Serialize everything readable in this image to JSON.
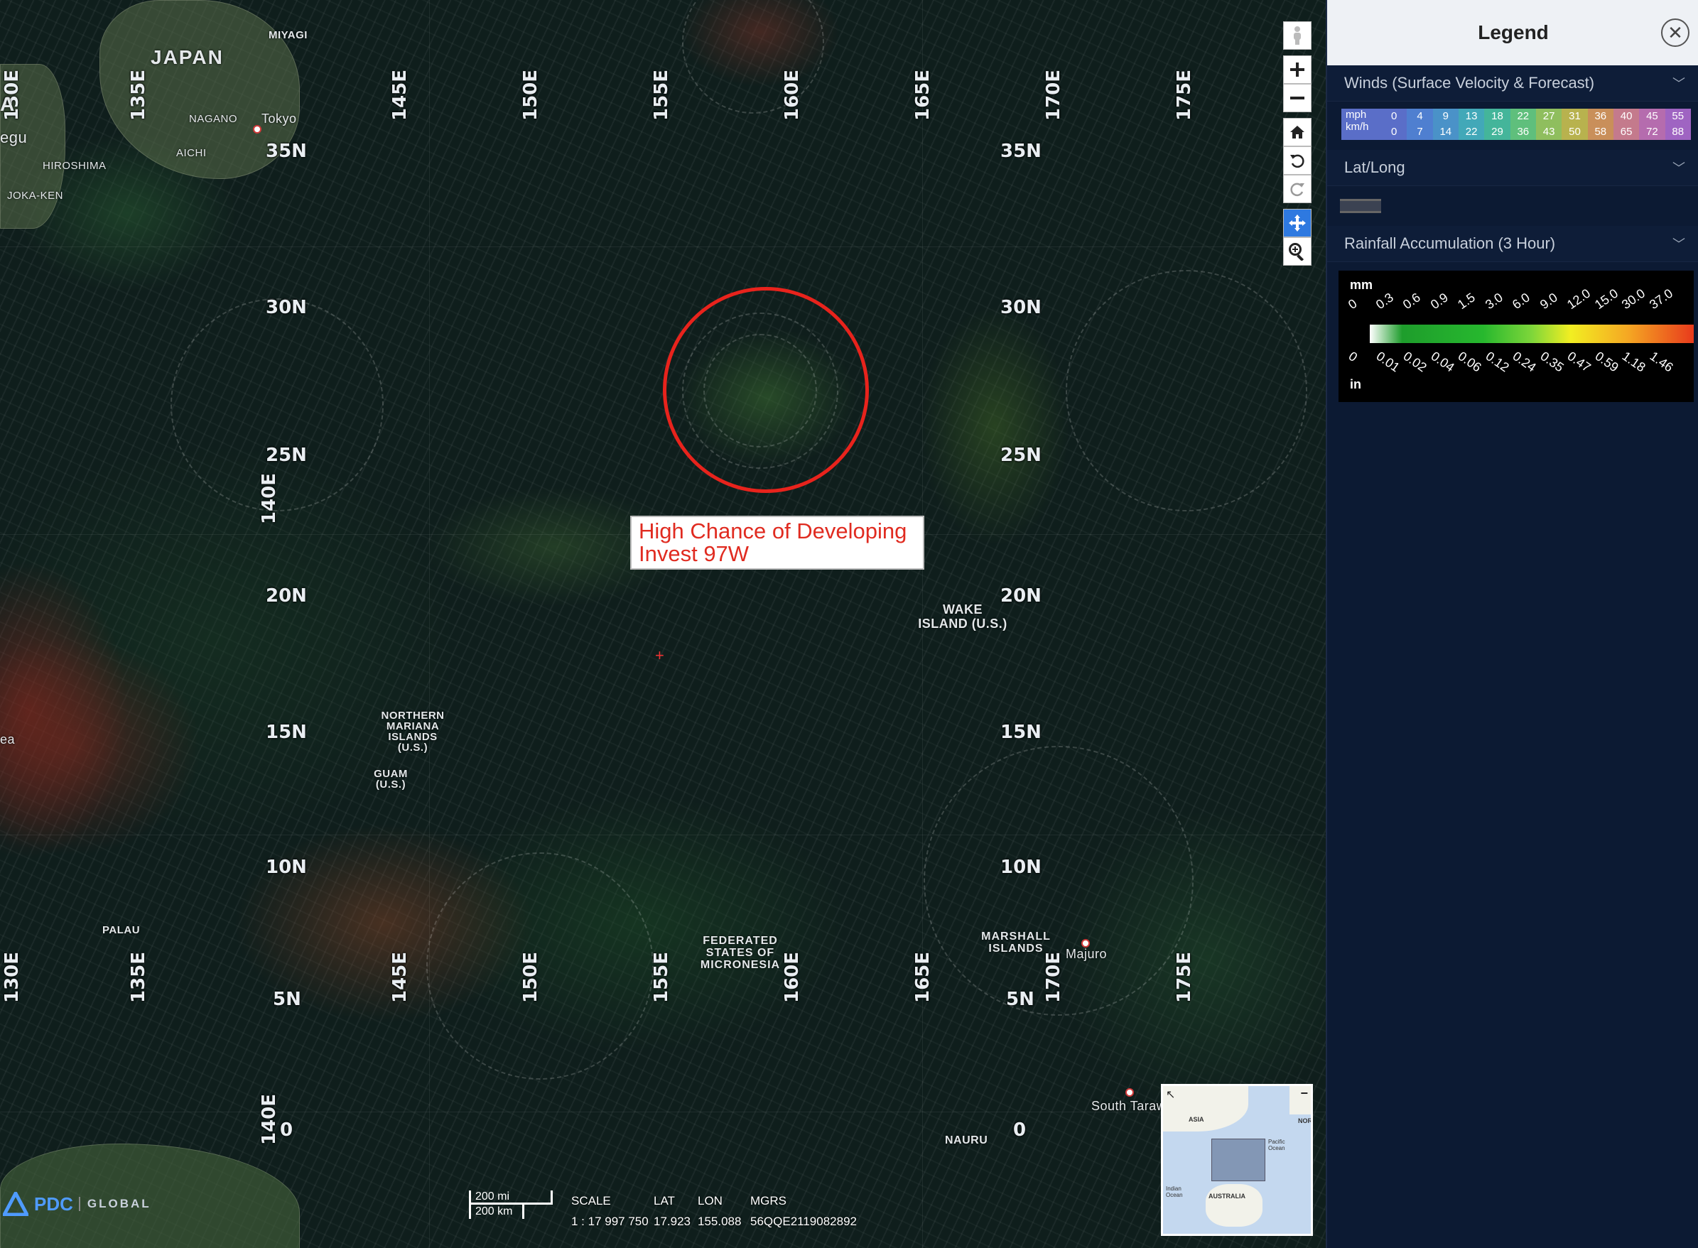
{
  "map": {
    "longitude_labels": [
      "130E",
      "135E",
      "140E",
      "145E",
      "150E",
      "155E",
      "160E",
      "165E",
      "170E",
      "175E"
    ],
    "latitude_labels": [
      "35N",
      "30N",
      "25N",
      "20N",
      "15N",
      "10N",
      "5N",
      "0"
    ],
    "places": {
      "japan": "JAPAN",
      "miyagi": "MIYAGI",
      "nagano": "NAGANO",
      "tokyo": "Tokyo",
      "aichi": "AICHI",
      "hiroshima": "HIROSHIMA",
      "fukuoka": "JOKA-KEN",
      "korea_partial": "A",
      "daegu_partial": "egu",
      "wake_island": "WAKE ISLAND (U.S.)",
      "northern_mariana": "NORTHERN MARIANA ISLANDS (U.S.)",
      "guam": "GUAM (U.S.)",
      "palau": "PALAU",
      "micronesia": "FEDERATED STATES OF MICRONESIA",
      "marshall": "MARSHALL ISLANDS",
      "majuro": "Majuro",
      "south_tarawa": "South Taraw",
      "nauru": "NAURU",
      "ea_partial": "ea"
    },
    "annotation": {
      "line1": "High Chance of Developing",
      "line2": "Invest 97W",
      "color": "#e02b20"
    },
    "storm_circle_color": "#e8231c"
  },
  "tools": [
    "street-view",
    "zoom-in",
    "zoom-out",
    "home",
    "rotate-left",
    "rotate-right",
    "pan",
    "zoom-box"
  ],
  "legend": {
    "title": "Legend",
    "close_icon": "close-icon",
    "sections": {
      "winds": {
        "title": "Winds (Surface Velocity & Forecast)",
        "mph_label": "mph",
        "kmh_label": "km/h",
        "mph": [
          "0",
          "4",
          "9",
          "13",
          "18",
          "22",
          "27",
          "31",
          "36",
          "40",
          "45",
          "55"
        ],
        "kmh": [
          "0",
          "7",
          "14",
          "22",
          "29",
          "36",
          "43",
          "50",
          "58",
          "65",
          "72",
          "88"
        ],
        "colors": [
          "#5a6ec8",
          "#4f7fd0",
          "#4a92c8",
          "#42a8b8",
          "#44b59a",
          "#5fbf7c",
          "#8fbe5e",
          "#b8b24e",
          "#c98f5a",
          "#c47a8c",
          "#b56cae",
          "#9f64c2"
        ]
      },
      "latlong": {
        "title": "Lat/Long"
      },
      "rainfall": {
        "title": "Rainfall Accumulation (3 Hour)",
        "mm_label": "mm",
        "in_label": "in",
        "mm_ticks": [
          "0",
          "0.3",
          "0.6",
          "0.9",
          "1.5",
          "3.0",
          "6.0",
          "9.0",
          "12.0",
          "15.0",
          "30.0",
          "37.0"
        ],
        "in_ticks": [
          "0",
          "0.01",
          "0.02",
          "0.04",
          "0.06",
          "0.12",
          "0.24",
          "0.35",
          "0.47",
          "0.59",
          "1.18",
          "1.46"
        ]
      }
    }
  },
  "footer": {
    "logo": "PDC",
    "logo_sub": "GLOBAL",
    "scale_mi": "200 mi",
    "scale_km": "200 km",
    "scale_label": "SCALE",
    "scale_value": "1 : 17 997 750",
    "lat_label": "LAT",
    "lat_value": "17.923",
    "lon_label": "LON",
    "lon_value": "155.088",
    "mgrs_label": "MGRS",
    "mgrs_value": "56QQE2119082892"
  },
  "overview_map": {
    "labels": [
      "ASIA",
      "AUSTRALIA",
      "NOR",
      "Pacific Ocean",
      "Indian Ocean"
    ]
  }
}
